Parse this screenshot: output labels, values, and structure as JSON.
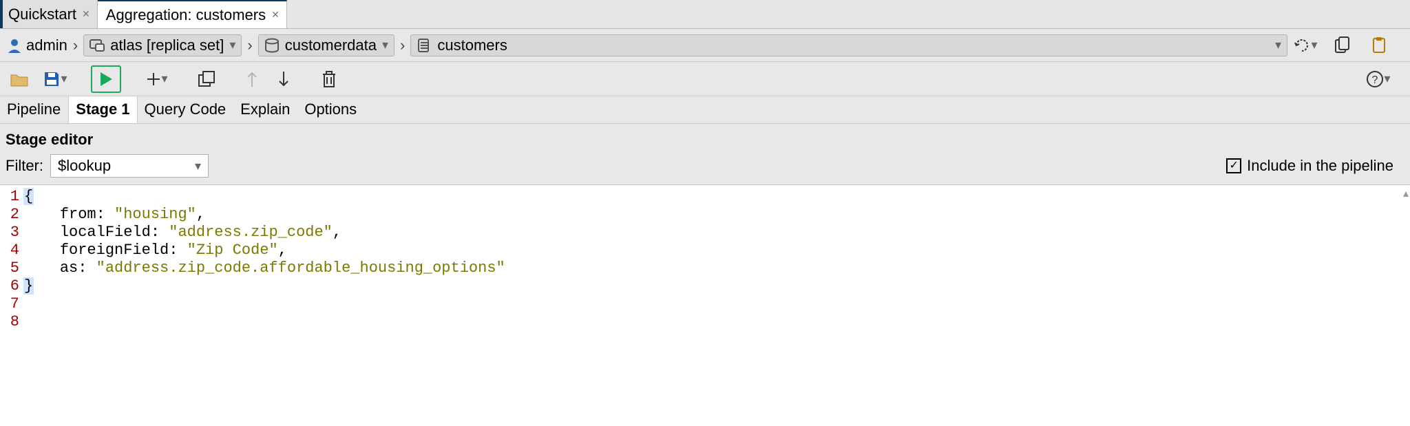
{
  "tabs": [
    {
      "label": "Quickstart",
      "active": false
    },
    {
      "label": "Aggregation: customers",
      "active": true
    }
  ],
  "breadcrumb": {
    "user": "admin",
    "server": "atlas [replica set]",
    "database": "customerdata",
    "collection": "customers"
  },
  "sub_tabs": [
    "Pipeline",
    "Stage 1",
    "Query Code",
    "Explain",
    "Options"
  ],
  "active_sub_tab": "Stage 1",
  "stage_editor": {
    "title": "Stage editor",
    "filter_label": "Filter:",
    "filter_value": "$lookup",
    "include_label": "Include in the pipeline",
    "include_checked": true
  },
  "code": {
    "lines": [
      {
        "n": 1,
        "tokens": [
          {
            "t": "brace",
            "v": "{"
          }
        ]
      },
      {
        "n": 2,
        "tokens": [
          {
            "t": "indent",
            "v": "    "
          },
          {
            "t": "key",
            "v": "from"
          },
          {
            "t": "punct",
            "v": ": "
          },
          {
            "t": "str",
            "v": "\"housing\""
          },
          {
            "t": "punct",
            "v": ","
          }
        ]
      },
      {
        "n": 3,
        "tokens": [
          {
            "t": "indent",
            "v": "    "
          },
          {
            "t": "key",
            "v": "localField"
          },
          {
            "t": "punct",
            "v": ": "
          },
          {
            "t": "str",
            "v": "\"address.zip_code\""
          },
          {
            "t": "punct",
            "v": ","
          }
        ]
      },
      {
        "n": 4,
        "tokens": [
          {
            "t": "indent",
            "v": "    "
          },
          {
            "t": "key",
            "v": "foreignField"
          },
          {
            "t": "punct",
            "v": ": "
          },
          {
            "t": "str",
            "v": "\"Zip Code\""
          },
          {
            "t": "punct",
            "v": ","
          }
        ]
      },
      {
        "n": 5,
        "tokens": [
          {
            "t": "indent",
            "v": "    "
          },
          {
            "t": "key",
            "v": "as"
          },
          {
            "t": "punct",
            "v": ": "
          },
          {
            "t": "str",
            "v": "\"address.zip_code.affordable_housing_options\""
          }
        ]
      },
      {
        "n": 6,
        "tokens": [
          {
            "t": "brace",
            "v": "}"
          }
        ]
      },
      {
        "n": 7,
        "tokens": []
      },
      {
        "n": 8,
        "tokens": []
      }
    ]
  }
}
